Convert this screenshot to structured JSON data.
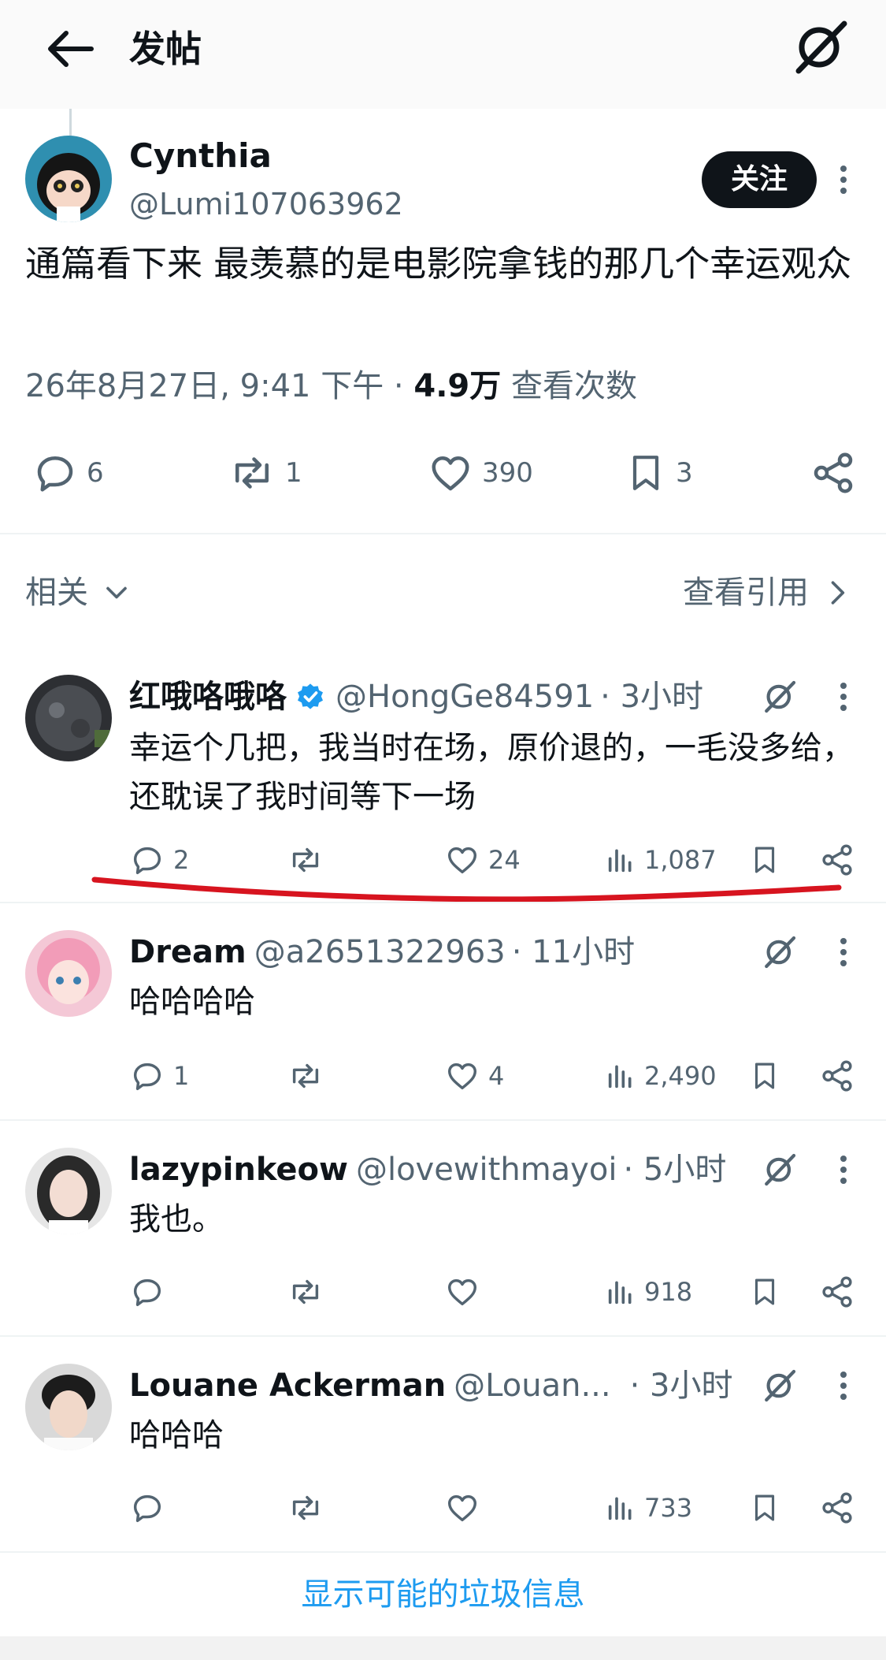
{
  "header": {
    "title": "发帖"
  },
  "post": {
    "name": "Cynthia",
    "handle": "@Lumi107063962",
    "follow_label": "关注",
    "text": "通篇看下来 最羡慕的是电影院拿钱的那几个幸运观众",
    "date": "26年8月27日, 9:41 下午 ·",
    "views": "4.9万",
    "views_label": "查看次数",
    "replies": "6",
    "reposts": "1",
    "likes": "390",
    "bookmarks": "3"
  },
  "related": {
    "label": "相关",
    "quotes_label": "查看引用"
  },
  "replies": [
    {
      "name": "红哦咯哦咯",
      "verified": true,
      "handle": "@HongGe84591",
      "time": "· 3小时",
      "text": "幸运个几把，我当时在场，原价退的，一毛没多给，还耽误了我时间等下一场",
      "replies": "2",
      "reposts": "",
      "likes": "24",
      "views": "1,087"
    },
    {
      "name": "Dream",
      "handle": "@a2651322963",
      "time": "· 11小时",
      "text": "哈哈哈哈",
      "replies": "1",
      "reposts": "",
      "likes": "4",
      "views": "2,490"
    },
    {
      "name": "lazypinkeow",
      "handle": "@lovewithmayoi",
      "time": "· 5小时",
      "text": "我也。",
      "replies": "",
      "reposts": "",
      "likes": "",
      "views": "918"
    },
    {
      "name": "Louane Ackerman",
      "handle": "@Louan...",
      "time": "· 3小时",
      "text": "哈哈哈",
      "replies": "",
      "reposts": "",
      "likes": "",
      "views": "733"
    }
  ],
  "footer": {
    "spam_label": "显示可能的垃圾信息"
  },
  "colors": {
    "accent": "#1d9bf0",
    "annotation": "#d7141f",
    "text": "#0f1419",
    "secondary": "#536471"
  },
  "icons": [
    "back-arrow-icon",
    "grok-icon",
    "more-dots-icon",
    "reply-icon",
    "repost-icon",
    "like-icon",
    "bookmark-icon",
    "share-icon",
    "views-icon",
    "chevron-down-icon",
    "chevron-right-icon",
    "verified-badge-icon"
  ]
}
